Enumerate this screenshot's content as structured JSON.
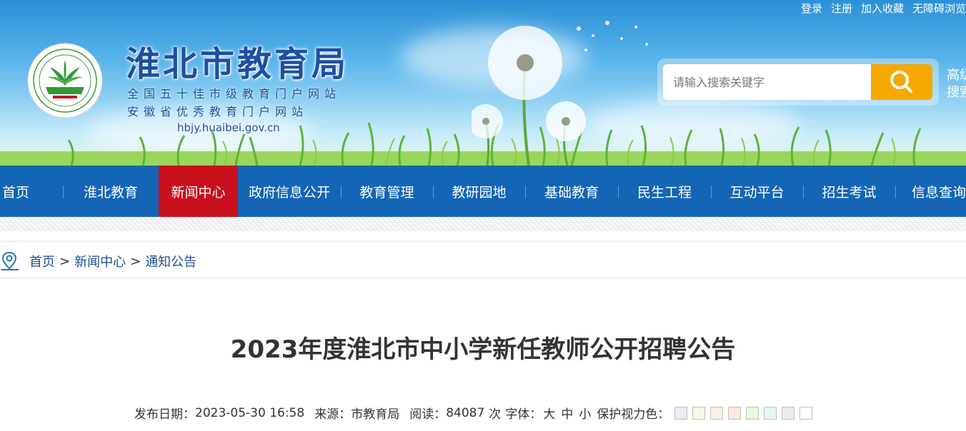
{
  "top_links": [
    "登录",
    "注册",
    "加入收藏",
    "无障碍浏览"
  ],
  "site": {
    "title": "淮北市教育局",
    "subtitle1": "全国五十佳市级教育门户网站",
    "subtitle2": "安徽省优秀教育门户网站",
    "domain": "hbjy.huaibei.gov.cn"
  },
  "search": {
    "placeholder": "请输入搜索关键字",
    "advanced_label": "高级搜索"
  },
  "nav": [
    {
      "label": "首页",
      "active": false
    },
    {
      "label": "淮北教育",
      "active": false
    },
    {
      "label": "新闻中心",
      "active": true
    },
    {
      "label": "政府信息公开",
      "active": false
    },
    {
      "label": "教育管理",
      "active": false
    },
    {
      "label": "教研园地",
      "active": false
    },
    {
      "label": "基础教育",
      "active": false
    },
    {
      "label": "民生工程",
      "active": false
    },
    {
      "label": "互动平台",
      "active": false
    },
    {
      "label": "招生考试",
      "active": false
    },
    {
      "label": "信息查询",
      "active": false
    }
  ],
  "breadcrumb": [
    "首页",
    "新闻中心",
    "通知公告"
  ],
  "article": {
    "title": "2023年度淮北市中小学新任教师公开招聘公告",
    "publish_label": "发布日期：",
    "publish_date": "2023-05-30 16:58",
    "source_label": "来源：",
    "source": "市教育局",
    "read_label": "阅读：",
    "read_count": "84087",
    "read_unit": "次",
    "font_label": "字体：",
    "font_sizes": [
      "大",
      "中",
      "小"
    ],
    "eye_color_label": "保护视力色：",
    "eye_colors": [
      "#e9ecf2",
      "#fbf7e5",
      "#fbeee2",
      "#fde6e2",
      "#ecf8dc",
      "#e3f6ef",
      "#ebebf1",
      "#ffffff"
    ]
  }
}
